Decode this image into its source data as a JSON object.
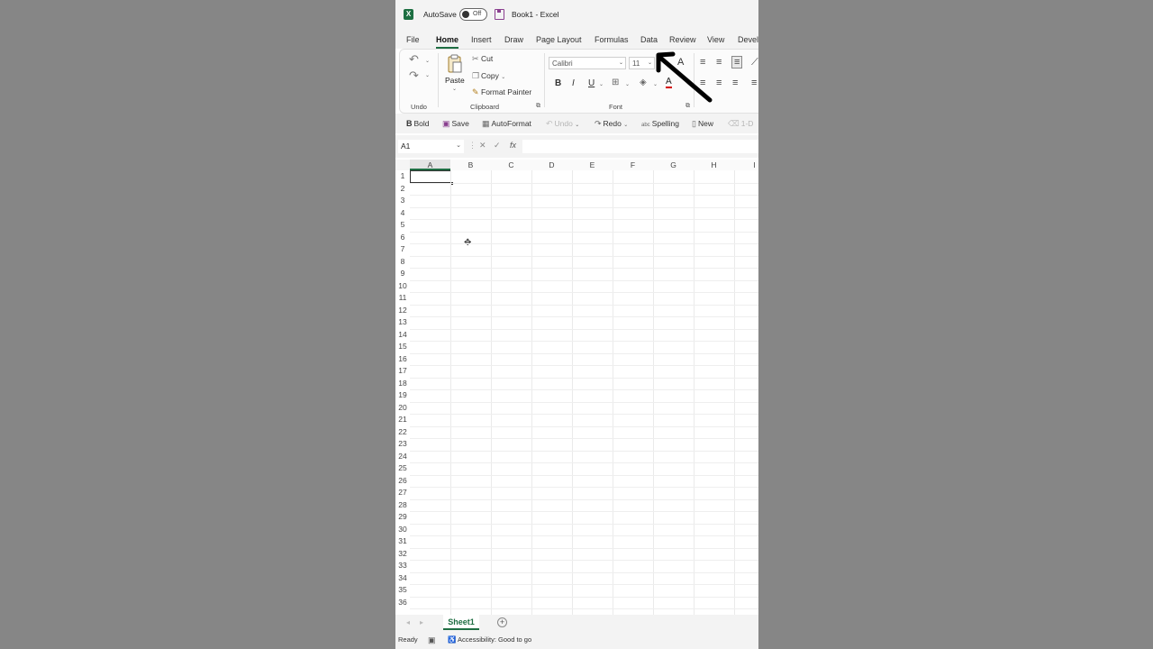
{
  "titlebar": {
    "autosave_label": "AutoSave",
    "toggle_state": "Off",
    "document_title": "Book1  -  Excel",
    "app_logo": "X"
  },
  "tabs": [
    "File",
    "Home",
    "Insert",
    "Draw",
    "Page Layout",
    "Formulas",
    "Data",
    "Review",
    "View",
    "Devel"
  ],
  "active_tab": "Home",
  "ribbon": {
    "undo_group_label": "Undo",
    "clipboard": {
      "paste_label": "Paste",
      "cut_label": "Cut",
      "copy_label": "Copy",
      "format_painter_label": "Format Painter",
      "group_label": "Clipboard"
    },
    "font": {
      "font_name": "Calibri",
      "font_size": "11",
      "bold": "B",
      "italic": "I",
      "underline": "U",
      "font_color_glyph": "A",
      "grow_font_glyph": "A",
      "group_label": "Font"
    }
  },
  "qat": {
    "bold_label": "Bold",
    "bold_glyph": "B",
    "save_label": "Save",
    "autoformat_label": "AutoFormat",
    "undo_label": "Undo",
    "redo_label": "Redo",
    "spelling_label": "Spelling",
    "spelling_glyph": "abc",
    "new_label": "New",
    "trailing_label": "1-D"
  },
  "formula_bar": {
    "name_box": "A1",
    "cancel_glyph": "✕",
    "enter_glyph": "✓",
    "fx_glyph": "fx",
    "formula": ""
  },
  "grid": {
    "columns": [
      "A",
      "B",
      "C",
      "D",
      "E",
      "F",
      "G",
      "H",
      "I"
    ],
    "rows": [
      "1",
      "2",
      "3",
      "4",
      "5",
      "6",
      "7",
      "8",
      "9",
      "10",
      "11",
      "12",
      "13",
      "14",
      "15",
      "16",
      "17",
      "18",
      "19",
      "20",
      "21",
      "22",
      "23",
      "24",
      "25",
      "26",
      "27",
      "28",
      "29",
      "30",
      "31",
      "32",
      "33",
      "34",
      "35",
      "36"
    ],
    "active_cell": "A1"
  },
  "sheets": [
    "Sheet1"
  ],
  "add_sheet_glyph": "+",
  "status": {
    "ready": "Ready",
    "accessibility": "Accessibility: Good to go"
  },
  "colors": {
    "excel_green": "#1f6e43",
    "background": "#868686",
    "save_purple": "#8a3f8f",
    "font_color_red": "#d40000"
  }
}
